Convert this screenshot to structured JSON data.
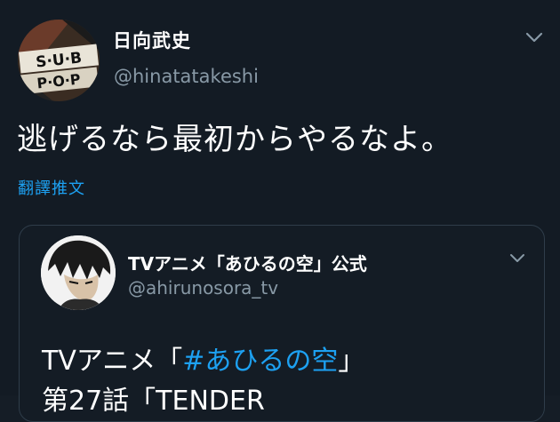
{
  "tweet": {
    "display_name": "日向武史",
    "handle": "@hinatatakeshi",
    "text": "逃げるなら最初からやるなよ。",
    "translate_label": "翻譯推文",
    "avatar_logo_text": "SUB POP"
  },
  "quoted_tweet": {
    "display_name": "TVアニメ「あひるの空」公式",
    "handle": "@ahirunosora_tv",
    "line1_prefix": "TVアニメ",
    "line1_open_bracket": "「",
    "hashtag": "#あひるの空",
    "line1_close_bracket": "」",
    "line2": "第27話「TENDER"
  },
  "colors": {
    "background": "#131b24",
    "link": "#1da1f2",
    "muted": "#8899a6",
    "border": "#2f3d4a"
  },
  "icons": {
    "caret": "chevron-down-icon"
  }
}
